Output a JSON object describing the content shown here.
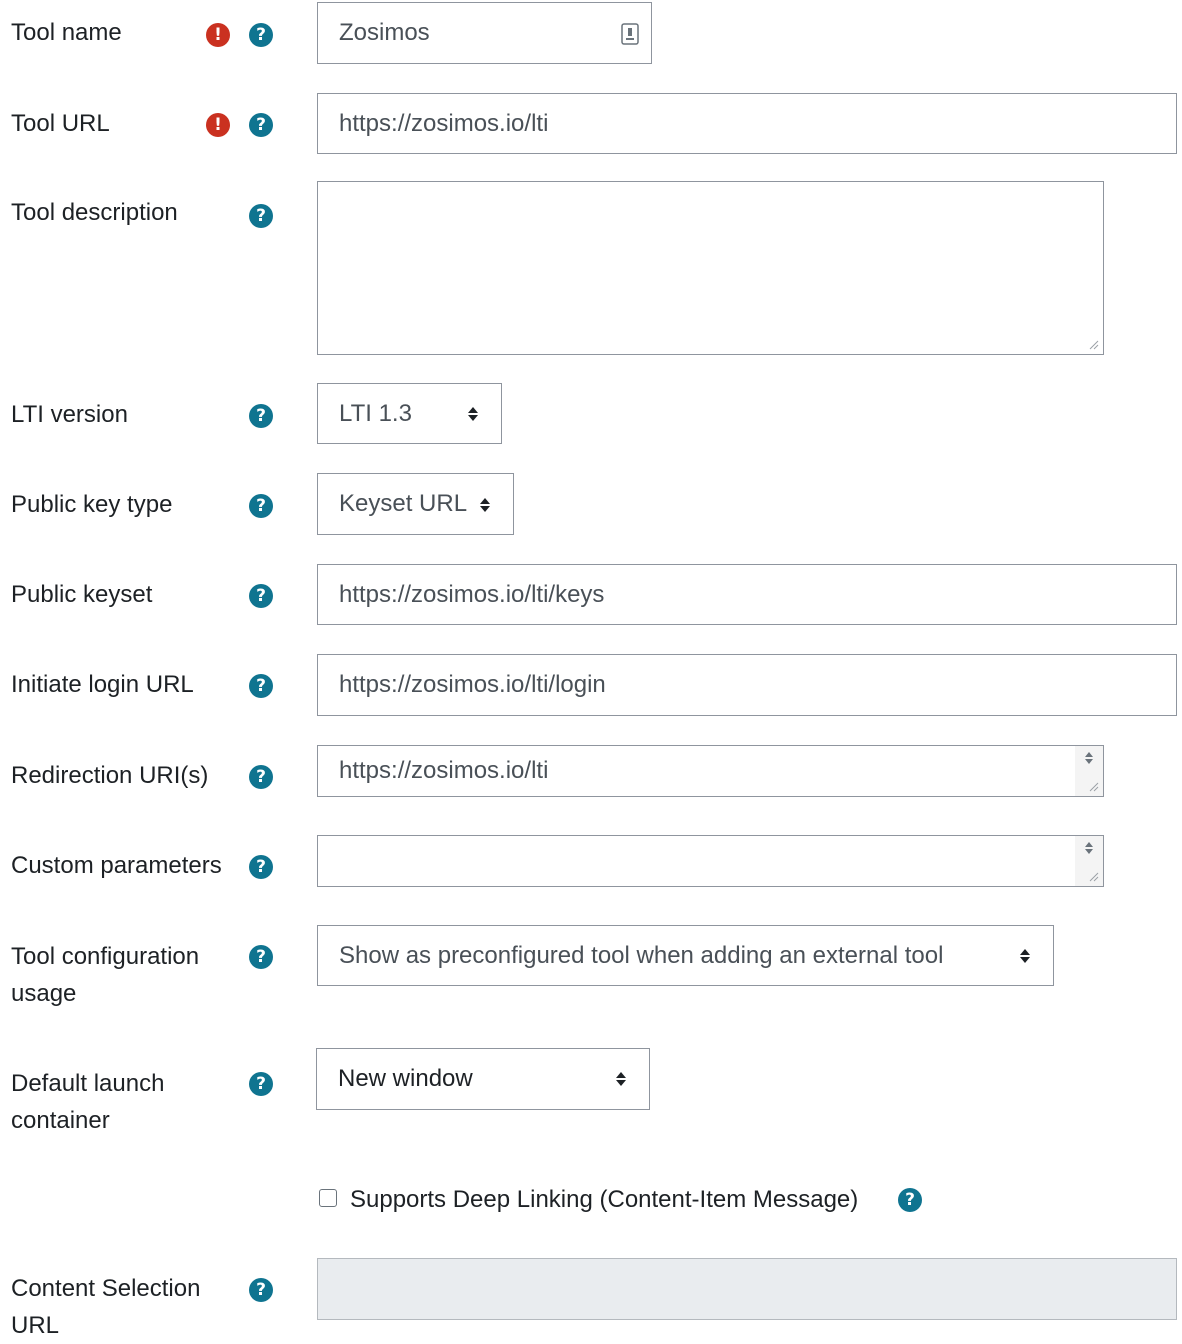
{
  "form": {
    "tool_name": {
      "label": "Tool name",
      "value": "Zosimos"
    },
    "tool_url": {
      "label": "Tool URL",
      "value": "https://zosimos.io/lti"
    },
    "tool_description": {
      "label": "Tool description",
      "value": ""
    },
    "lti_version": {
      "label": "LTI version",
      "selected": "LTI 1.3"
    },
    "public_key_type": {
      "label": "Public key type",
      "selected": "Keyset URL"
    },
    "public_keyset": {
      "label": "Public keyset",
      "value": "https://zosimos.io/lti/keys"
    },
    "initiate_login_url": {
      "label": "Initiate login URL",
      "value": "https://zosimos.io/lti/login"
    },
    "redirection_uris": {
      "label": "Redirection URI(s)",
      "value": "https://zosimos.io/lti"
    },
    "custom_parameters": {
      "label": "Custom parameters",
      "value": ""
    },
    "tool_configuration_usage": {
      "label_line1": "Tool configuration",
      "label_line2": "usage",
      "selected": "Show as preconfigured tool when adding an external tool"
    },
    "default_launch_container": {
      "label_line1": "Default launch",
      "label_line2": "container",
      "selected": "New window"
    },
    "supports_deep_linking": {
      "label": "Supports Deep Linking (Content-Item Message)",
      "checked": false
    },
    "content_selection_url": {
      "label_line1": "Content Selection",
      "label_line2": "URL",
      "value": ""
    }
  },
  "icons": {
    "required": "exclamation-circle-icon",
    "help": "question-circle-icon"
  },
  "colors": {
    "required_icon": "#ca3120",
    "help_icon": "#0f7490",
    "field_border": "#8f959e",
    "disabled_field_bg": "#e9ecef"
  }
}
